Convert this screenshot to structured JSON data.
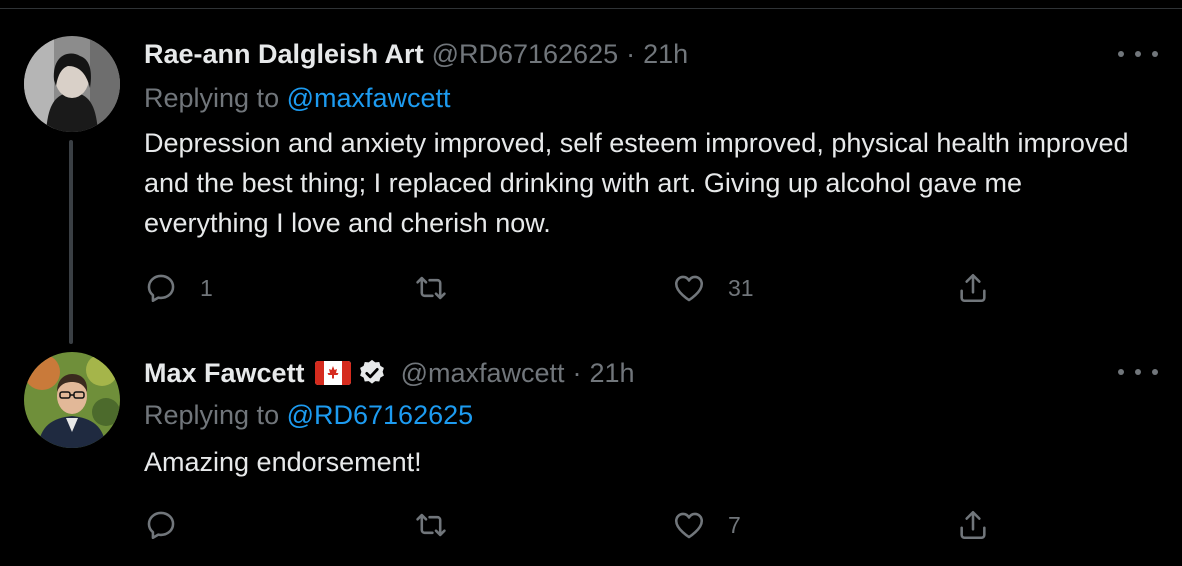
{
  "tweets": [
    {
      "author_name": "Rae-ann Dalgleish Art",
      "handle": "@RD67162625",
      "separator": "·",
      "time": "21h",
      "replying_prefix": "Replying to ",
      "replying_to": "@maxfawcett",
      "text": "Depression and anxiety improved, self esteem improved, physical health improved and the best thing; I replaced drinking with art. Giving up alcohol gave me everything I love and cherish now.",
      "reply_count": "1",
      "retweet_count": "",
      "like_count": "31"
    },
    {
      "author_name": "Max Fawcett",
      "handle": "@maxfawcett",
      "separator": "·",
      "time": "21h",
      "replying_prefix": "Replying to ",
      "replying_to": "@RD67162625",
      "text": "Amazing endorsement!",
      "reply_count": "",
      "retweet_count": "",
      "like_count": "7"
    }
  ],
  "icons": {
    "reply": "reply-icon",
    "retweet": "retweet-icon",
    "like": "heart-icon",
    "share": "share-icon",
    "more": "more-icon",
    "flag": "canada-flag-icon",
    "verified": "verified-badge-icon"
  },
  "colors": {
    "background": "#000000",
    "text": "#e7e9ea",
    "muted": "#71767b",
    "link": "#1d9bf0"
  }
}
